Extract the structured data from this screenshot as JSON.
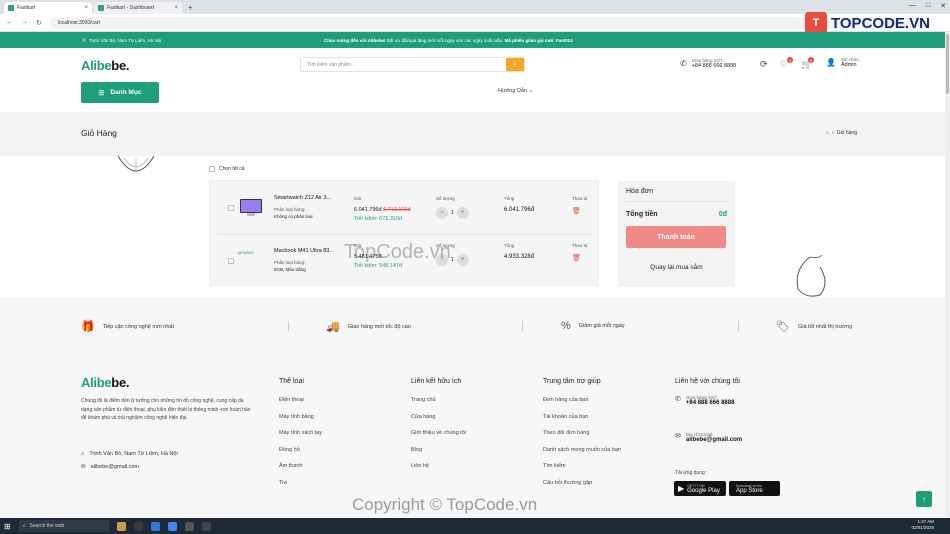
{
  "browser": {
    "tabs": [
      {
        "title": "Fastkart",
        "active": true
      },
      {
        "title": "Fastkart - Dashboard",
        "active": false
      }
    ],
    "url": "localhost:3000/cart",
    "controls": [
      "—",
      "□",
      "✕"
    ]
  },
  "announcement": {
    "address": "Trịnh Văn Bô, Nam Từ Liêm, Hà Nội",
    "welcome": "Chào mừng đến với Alibebe!",
    "text": " Bất ưu đãi/quà tặng mới mỗi ngày vào các ngày cuối tuần. ",
    "code": "Mã phiếu giảm giá mới: Fast024"
  },
  "header": {
    "logo_main": "Alibe",
    "logo_end": "be.",
    "search_placeholder": "Tìm kiếm sản phẩm...",
    "hotline_label": "Giao hàng 24/7",
    "hotline_number": "+84 888 666 8888",
    "wishlist_count": "0",
    "cart_count": "0",
    "greeting": "Xin chào,",
    "username": "Admin",
    "category_button": "Danh Mục",
    "guide_menu": "Hướng Dẫn"
  },
  "page": {
    "title": "Giỏ Hàng",
    "breadcrumb": "Giỏ hàng"
  },
  "cart": {
    "select_all": "Chọn tất cả",
    "col_price": "Giá",
    "col_qty": "Số lượng",
    "col_total": "Tổng",
    "col_action": "Thao tá",
    "variant_label": "Phân loại hàng:",
    "items": [
      {
        "name": "Smartwatch Z12 Air 3...",
        "variant": "Không có phân loại",
        "price": "6.041.796đ",
        "old_price": "6.713.106đ",
        "saving": "Tiết kiệm: 671.310đ",
        "qty": "1",
        "total": "6.041.796đ",
        "image_alt": ""
      },
      {
        "name": "Macbook M41 Ultra 83...",
        "variant": "8GB, Màu trắng",
        "price": "5.481.475đ",
        "old_price": "",
        "saving": "Tiết kiệm: 548.147đ",
        "qty": "1",
        "total": "4.933.328đ",
        "image_alt": "product"
      }
    ]
  },
  "invoice": {
    "title": "Hóa đơn",
    "total_label": "Tổng tiền",
    "total_value": "0đ",
    "pay_button": "Thanh toán",
    "back_link": "Quay lại mua sắm"
  },
  "features": [
    {
      "label": "Tiếp cận công nghệ mới nhất",
      "icon": "gift-icon"
    },
    {
      "label": "Giao hàng mới tốc độ cao",
      "icon": "truck-icon"
    },
    {
      "label": "Giảm giá mỗi ngày",
      "icon": "discount-icon"
    },
    {
      "label": "Giá tốt nhất thị trường",
      "icon": "price-tag-icon"
    }
  ],
  "footer": {
    "about": "Chúng tôi là điểm đến lý tưởng cho những tín đồ công nghệ, cung cấp đa dạng sản phẩm từ điện thoại, phụ kiện đến thiết bị thông minh–nơi hoàn hảo để khám phá và trải nghiệm công nghệ hiện đại.",
    "address": "Trịnh Văn Bô, Nam Từ Liêm, Hà Nội",
    "email": "alibebe@gmail.com",
    "columns": [
      {
        "title": "Thể loại",
        "items": [
          "Điện thoại",
          "Máy tính bảng",
          "Máy tính xách tay",
          "Đồng hồ",
          "Âm thanh",
          "Tivi"
        ]
      },
      {
        "title": "Liên kết hữu ích",
        "items": [
          "Trang chủ",
          "Cửa hàng",
          "Giới thiệu về chúng tôi",
          "Blog",
          "Liên hệ"
        ]
      },
      {
        "title": "Trung tâm trợ giúp",
        "items": [
          "Đơn hàng của bạn",
          "Tài khoản của bạn",
          "Theo dõi đơn hàng",
          "Danh sách mong muốn của bạn",
          "Tìm kiếm",
          "Câu hỏi thường gặp"
        ]
      }
    ],
    "contact_title": "Liên hệ với chúng tôi",
    "contact_hotline_label": "Giao hàng 24/7",
    "contact_hotline": "+84 888 666 8888",
    "contact_email_label": "Địa chỉ Email:",
    "contact_email": "alibebe@gmail.com",
    "download_label": "Tải ứng dụng :",
    "google_play_small": "GET IT ON",
    "google_play": "Google Play",
    "app_store_small": "Download on the",
    "app_store": "App Store"
  },
  "taskbar": {
    "search": "Search the web",
    "time": "1:47 AM",
    "date": "02/01/2025"
  },
  "watermarks": {
    "center": "TopCode.vn",
    "brand": "TOPCODE.VN",
    "copyright": "Copyright © TopCode.vn"
  },
  "colors": {
    "brand_green": "#1f9e7b",
    "accent_orange": "#f5a623",
    "danger_red": "#e74c3c",
    "pay_button": "#f08a87"
  }
}
